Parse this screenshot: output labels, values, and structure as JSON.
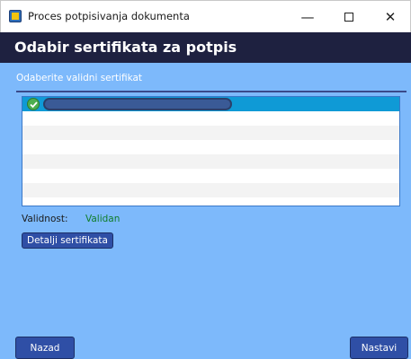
{
  "window": {
    "title": "Proces potpisivanja dokumenta",
    "minimize_glyph": "—",
    "close_glyph": "✕"
  },
  "header": {
    "title": "Odabir sertifikata za potpis"
  },
  "main": {
    "subtitle": "Odaberite validni sertifikat",
    "certificates": [
      {
        "status_icon": "check-icon",
        "selected": true
      }
    ],
    "validity_label": "Validnost:",
    "validity_value": "Validan",
    "details_button": "Detalji sertifikata"
  },
  "footer": {
    "back_button": "Nazad",
    "next_button": "Nastavi"
  },
  "colors": {
    "header_bg": "#1e2140",
    "content_bg": "#7db9fb",
    "selected_row": "#0f9ad6",
    "button_bg": "#2f4fa6",
    "valid_text": "#0f7d2a"
  }
}
